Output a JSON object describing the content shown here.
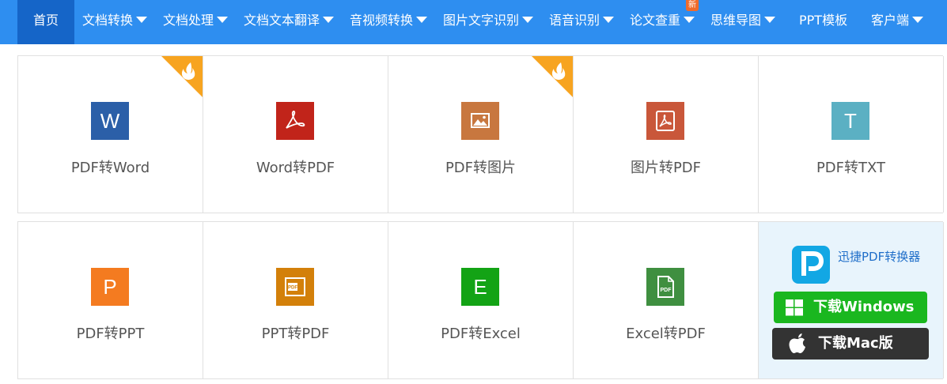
{
  "nav": {
    "items": [
      {
        "label": "首页",
        "dropdown": false,
        "active": true
      },
      {
        "label": "文档转换",
        "dropdown": true
      },
      {
        "label": "文档处理",
        "dropdown": true
      },
      {
        "label": "文档文本翻译",
        "dropdown": true
      },
      {
        "label": "音视频转换",
        "dropdown": true
      },
      {
        "label": "图片文字识别",
        "dropdown": true
      },
      {
        "label": "语音识别",
        "dropdown": true
      },
      {
        "label": "论文查重",
        "dropdown": true,
        "badge": "新"
      },
      {
        "label": "思维导图",
        "dropdown": true
      },
      {
        "label": "PPT模板",
        "dropdown": false
      },
      {
        "label": "客户端",
        "dropdown": true
      }
    ]
  },
  "tools": [
    {
      "label": "PDF转Word",
      "glyph": "W",
      "icon": "word-icon",
      "color": "#2b5fa8",
      "hot": true
    },
    {
      "label": "Word转PDF",
      "glyph": "",
      "icon": "acrobat-icon",
      "color": "#c1241a",
      "hot": false
    },
    {
      "label": "PDF转图片",
      "glyph": "",
      "icon": "image-icon",
      "color": "#c8773f",
      "hot": true
    },
    {
      "label": "图片转PDF",
      "glyph": "",
      "icon": "acrobat-framed-icon",
      "color": "#c9573a",
      "hot": false
    },
    {
      "label": "PDF转TXT",
      "glyph": "T",
      "icon": "text-icon",
      "color": "#5bb0c3",
      "hot": false
    },
    {
      "label": "PDF转PPT",
      "glyph": "P",
      "icon": "powerpoint-icon",
      "color": "#f47b20",
      "hot": false
    },
    {
      "label": "PPT转PDF",
      "glyph": "",
      "icon": "ppt-pdf-icon",
      "color": "#d3800a",
      "hot": false
    },
    {
      "label": "PDF转Excel",
      "glyph": "E",
      "icon": "excel-icon",
      "color": "#13a315",
      "hot": false
    },
    {
      "label": "Excel转PDF",
      "glyph": "",
      "icon": "pdf-file-icon",
      "color": "#3f8f40",
      "hot": false
    }
  ],
  "download": {
    "app_name": "迅捷PDF转换器",
    "windows_label": "下载Windows版",
    "mac_label": "下载Mac版"
  },
  "colors": {
    "nav_bg": "#2e8ef0",
    "nav_active": "#1565c8",
    "hot_corner": "#f7a420",
    "badge": "#f06b2b"
  }
}
